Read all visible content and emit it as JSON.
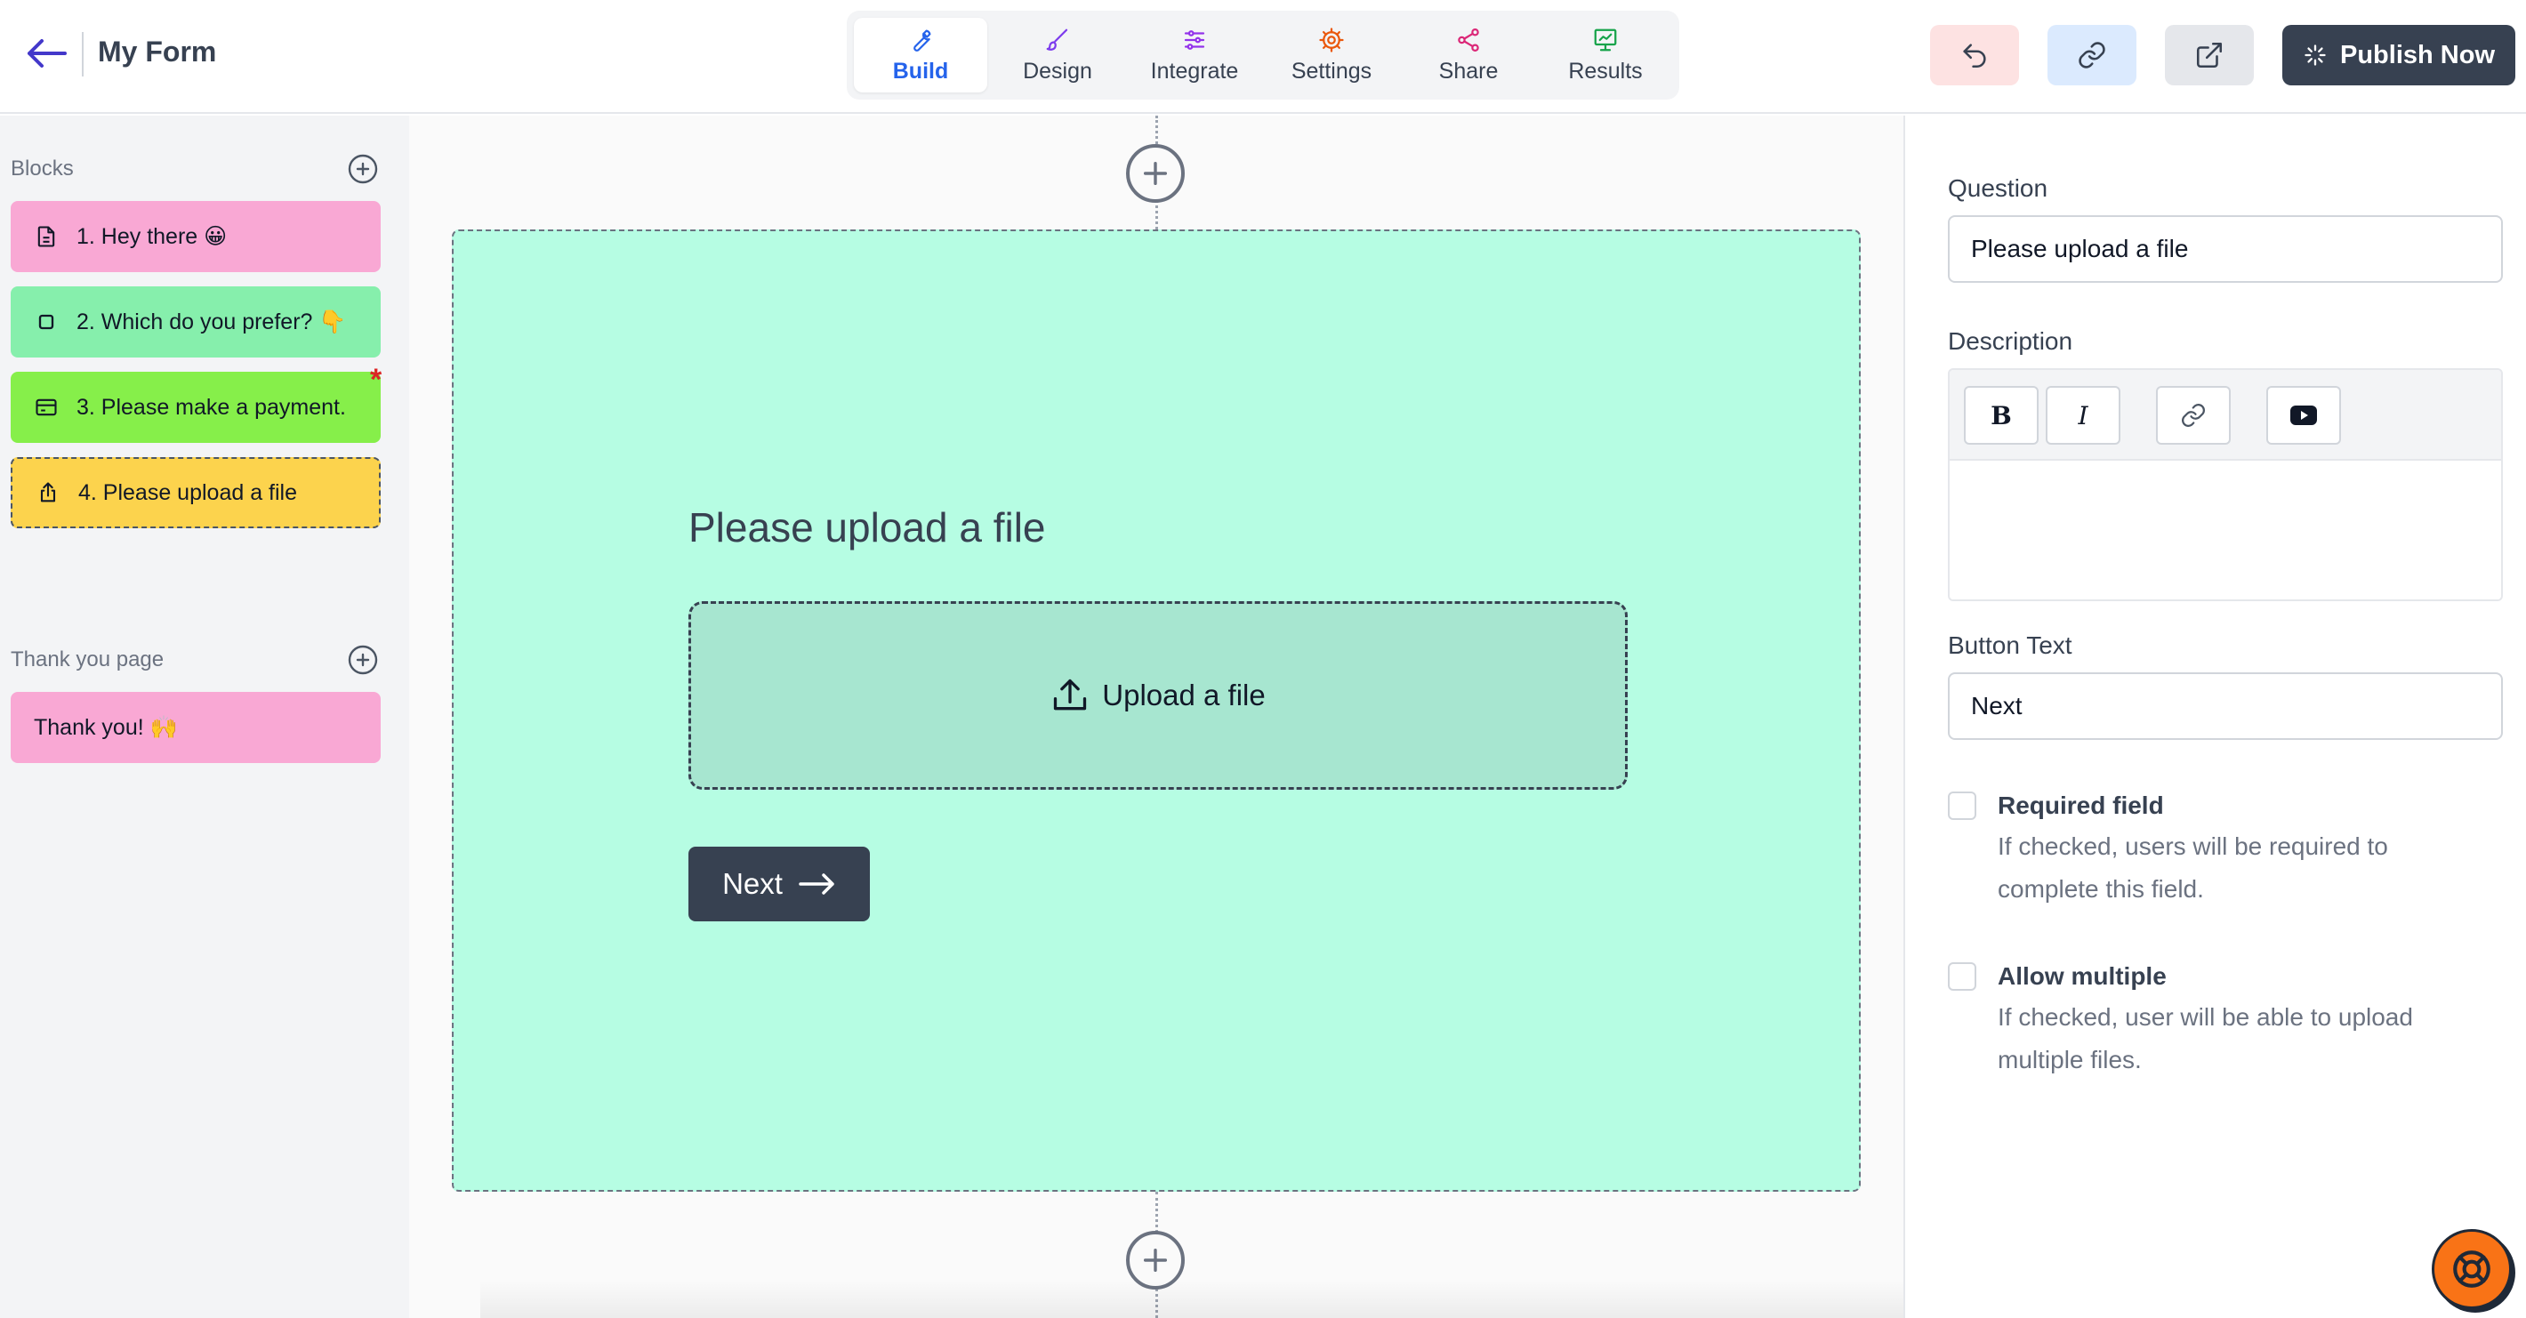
{
  "header": {
    "title": "My Form",
    "tabs": [
      {
        "label": "Build",
        "icon": "wrench-icon",
        "color": "#2563eb",
        "active": true
      },
      {
        "label": "Design",
        "icon": "brush-icon",
        "color": "#7c3aed",
        "active": false
      },
      {
        "label": "Integrate",
        "icon": "sliders-icon",
        "color": "#9333ea",
        "active": false
      },
      {
        "label": "Settings",
        "icon": "gear-icon",
        "color": "#ea580c",
        "active": false
      },
      {
        "label": "Share",
        "icon": "share-icon",
        "color": "#db2777",
        "active": false
      },
      {
        "label": "Results",
        "icon": "chart-icon",
        "color": "#16a34a",
        "active": false
      }
    ],
    "publish_label": "Publish Now"
  },
  "sidebar": {
    "blocks_heading": "Blocks",
    "blocks": [
      {
        "label": "1. Hey there 😀",
        "icon": "document-icon",
        "color": "#f9a8d4"
      },
      {
        "label": "2. Which do you prefer? 👇",
        "icon": "checkbox-icon",
        "color": "#86efac"
      },
      {
        "label": "3. Please make a payment.",
        "icon": "credit-card-icon",
        "color": "#86ef4a",
        "required": true
      },
      {
        "label": "4. Please upload a file",
        "icon": "upload-icon",
        "color": "#fcd34d",
        "selected": true
      }
    ],
    "required_mark": "*",
    "thanks_heading": "Thank you page",
    "thanks_blocks": [
      {
        "label": "Thank you! 🙌",
        "color": "#f9a8d4"
      }
    ]
  },
  "canvas": {
    "card_color": "#b6fde3",
    "question_title": "Please upload a file",
    "upload_label": "Upload a file",
    "next_label": "Next"
  },
  "panel": {
    "question_label": "Question",
    "question_value": "Please upload a file",
    "description_label": "Description",
    "toolbar": {
      "bold": "B",
      "italic": "I"
    },
    "button_text_label": "Button Text",
    "button_text_value": "Next",
    "required": {
      "title": "Required field",
      "desc": "If checked, users will be required to complete this field."
    },
    "multiple": {
      "title": "Allow multiple",
      "desc": "If checked, user will be able to upload multiple files."
    }
  }
}
